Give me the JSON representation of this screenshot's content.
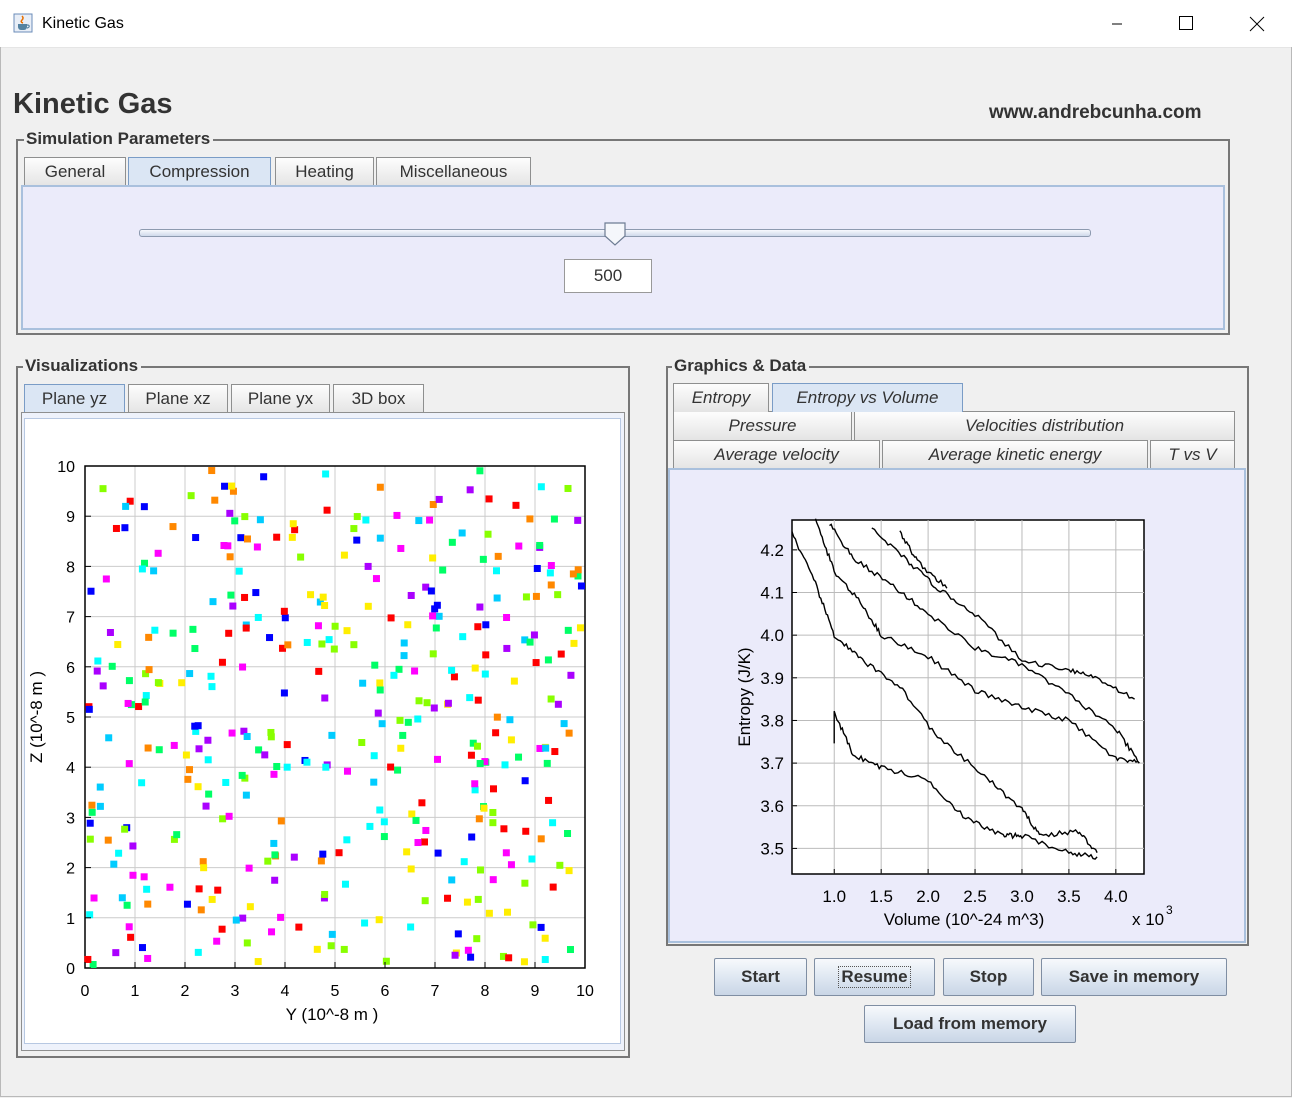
{
  "window": {
    "title": "Kinetic Gas",
    "icon": "java-cup-icon"
  },
  "header": {
    "title": "Kinetic Gas",
    "url": "www.andrebcunha.com"
  },
  "simulation_parameters": {
    "title": "Simulation Parameters",
    "tabs": [
      {
        "label": "General",
        "selected": false
      },
      {
        "label": "Compression",
        "selected": true
      },
      {
        "label": "Heating",
        "selected": false
      },
      {
        "label": "Miscellaneous",
        "selected": false
      }
    ],
    "slider_level": 0.5,
    "value": "500"
  },
  "visualizations": {
    "title": "Visualizations",
    "tabs": [
      {
        "label": "Plane yz",
        "selected": true
      },
      {
        "label": "Plane xz",
        "selected": false
      },
      {
        "label": "Plane yx",
        "selected": false
      },
      {
        "label": "3D box",
        "selected": false
      }
    ]
  },
  "graphics": {
    "title": "Graphics & Data",
    "tabs": [
      {
        "label": "Entropy",
        "selected": false
      },
      {
        "label": "Entropy vs Volume",
        "selected": true
      },
      {
        "label": "Pressure",
        "selected": false
      },
      {
        "label": "Velocities distribution",
        "selected": false
      },
      {
        "label": "Average velocity",
        "selected": false
      },
      {
        "label": "Average kinetic energy",
        "selected": false
      },
      {
        "label": "T vs V",
        "selected": false
      }
    ]
  },
  "buttons": {
    "start": "Start",
    "resume": "Resume",
    "stop": "Stop",
    "save": "Save in memory",
    "load": "Load from memory"
  },
  "colors": {
    "particles": [
      "#ff0000",
      "#ff00ff",
      "#0000ff",
      "#00ccff",
      "#00ff66",
      "#88ff00",
      "#ffee00",
      "#ff8800",
      "#aa00ff",
      "#00ffff"
    ],
    "tab_selected": "#dbe6f4",
    "panel_bg": "#ebebfa"
  },
  "chart_data": [
    {
      "type": "scatter",
      "xlabel": "Y (10^-8 m )",
      "ylabel": "Z (10^-8 m )",
      "xlim": [
        0,
        10
      ],
      "ylim": [
        0,
        10
      ],
      "x_ticks": [
        "0",
        "1",
        "2",
        "3",
        "4",
        "5",
        "6",
        "7",
        "8",
        "9",
        "10"
      ],
      "y_ticks": [
        "0",
        "1",
        "2",
        "3",
        "4",
        "5",
        "6",
        "7",
        "8",
        "9",
        "10"
      ],
      "grid": true,
      "particle_count": 400,
      "distribution": "uniform random particles, colored by speed"
    },
    {
      "type": "line",
      "xlabel": "Volume (10^-24 m^3)",
      "ylabel": "Entropy (J/K)",
      "x_multiplier": "x 10",
      "x_multiplier_exp": "3",
      "xlim": [
        0.55,
        4.3
      ],
      "ylim": [
        3.44,
        4.27
      ],
      "x_ticks": [
        "1.0",
        "1.5",
        "2.0",
        "2.5",
        "3.0",
        "3.5",
        "4.0"
      ],
      "y_ticks": [
        "3.5",
        "3.6",
        "3.7",
        "3.8",
        "3.9",
        "4.0",
        "4.1",
        "4.2"
      ],
      "grid": true,
      "series": [
        {
          "points": [
            [
              1.0,
              3.75
            ],
            [
              1.0,
              3.82
            ],
            [
              1.2,
              3.72
            ],
            [
              1.5,
              3.69
            ],
            [
              2.0,
              3.66
            ],
            [
              2.4,
              3.57
            ],
            [
              2.8,
              3.53
            ],
            [
              3.0,
              3.53
            ],
            [
              3.5,
              3.49
            ],
            [
              3.8,
              3.48
            ]
          ]
        },
        {
          "points": [
            [
              0.55,
              4.24
            ],
            [
              0.8,
              4.12
            ],
            [
              1.0,
              4.0
            ],
            [
              1.3,
              3.94
            ],
            [
              1.7,
              3.88
            ],
            [
              2.1,
              3.76
            ],
            [
              2.6,
              3.67
            ],
            [
              3.0,
              3.59
            ],
            [
              3.2,
              3.53
            ],
            [
              3.6,
              3.54
            ],
            [
              3.8,
              3.49
            ]
          ]
        },
        {
          "points": [
            [
              0.8,
              4.27
            ],
            [
              1.0,
              4.15
            ],
            [
              1.3,
              4.07
            ],
            [
              1.5,
              4.0
            ],
            [
              2.0,
              3.95
            ],
            [
              2.5,
              3.87
            ],
            [
              3.0,
              3.83
            ],
            [
              3.5,
              3.8
            ],
            [
              4.0,
              3.71
            ],
            [
              4.25,
              3.7
            ]
          ]
        },
        {
          "points": [
            [
              0.95,
              4.26
            ],
            [
              1.2,
              4.18
            ],
            [
              1.6,
              4.12
            ],
            [
              2.0,
              4.05
            ],
            [
              2.5,
              3.97
            ],
            [
              3.0,
              3.93
            ],
            [
              3.5,
              3.86
            ],
            [
              4.0,
              3.78
            ],
            [
              4.25,
              3.7
            ]
          ]
        },
        {
          "points": [
            [
              1.4,
              4.25
            ],
            [
              1.8,
              4.17
            ],
            [
              2.1,
              4.11
            ],
            [
              2.5,
              4.05
            ],
            [
              3.0,
              3.94
            ],
            [
              3.5,
              3.92
            ],
            [
              3.8,
              3.9
            ],
            [
              4.2,
              3.85
            ]
          ]
        },
        {
          "points": [
            [
              1.7,
              4.24
            ],
            [
              1.9,
              4.17
            ],
            [
              2.2,
              4.11
            ]
          ]
        }
      ]
    }
  ]
}
